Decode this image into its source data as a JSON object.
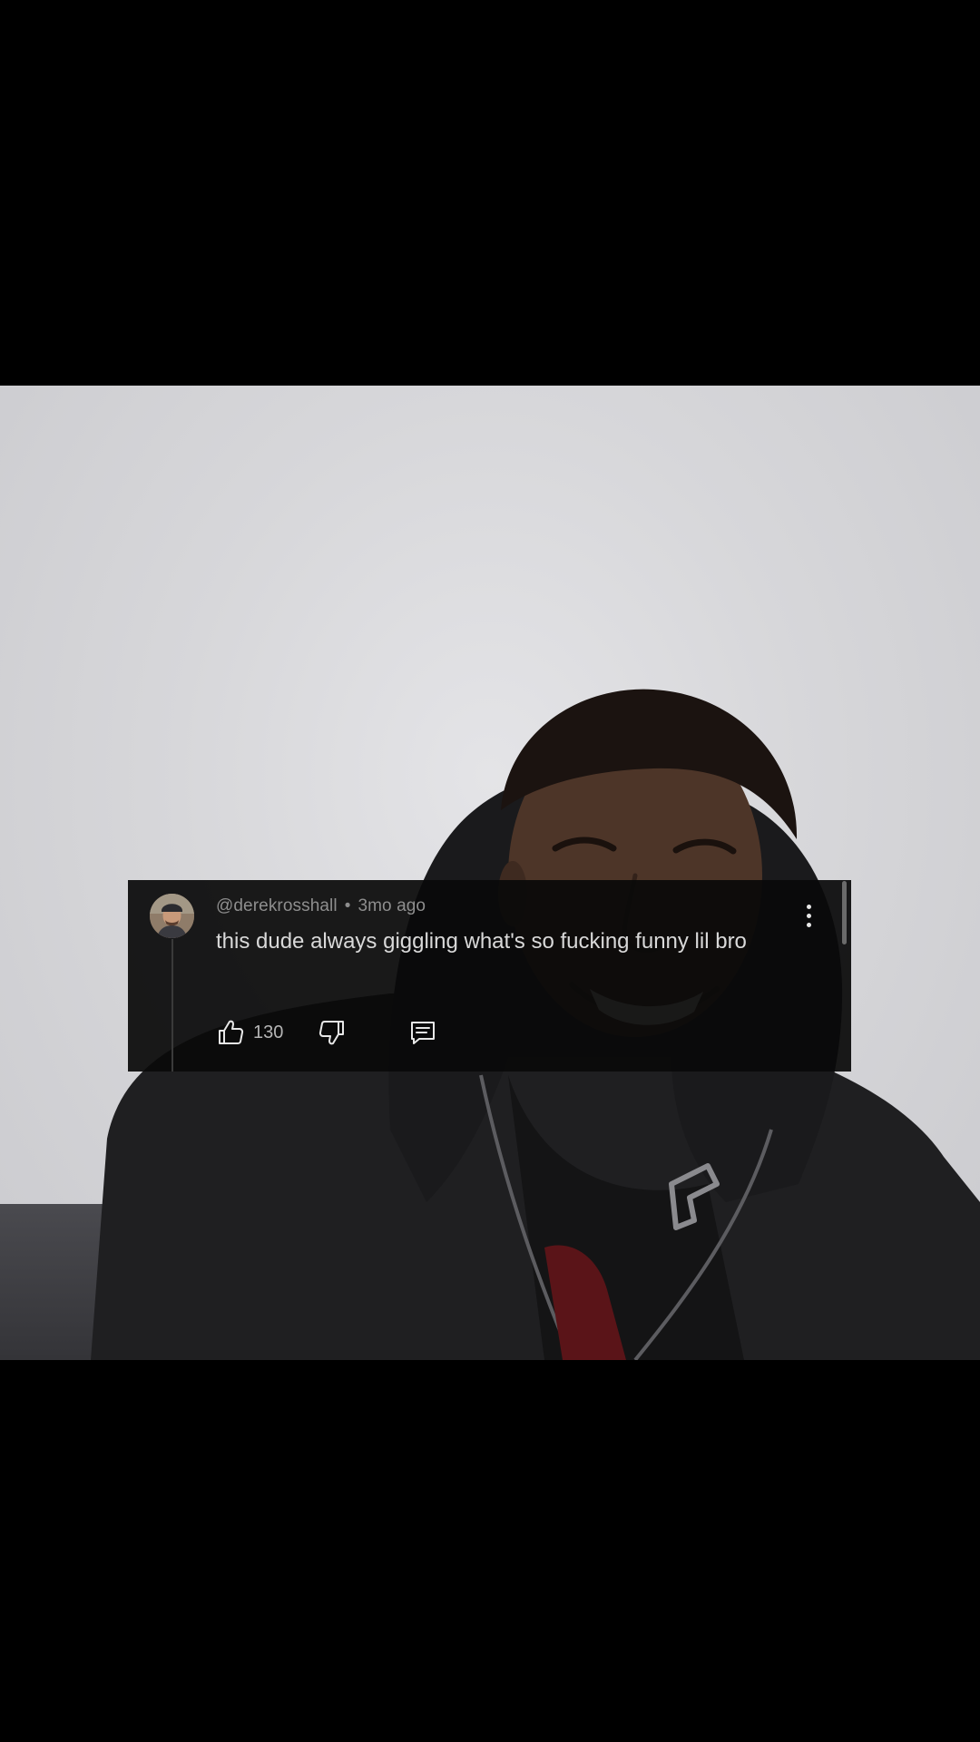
{
  "comment": {
    "author": "@derekrosshall",
    "separator": "•",
    "timestamp": "3mo ago",
    "text": "this dude always giggling what's so fucking funny lil bro",
    "like_count": "130",
    "icons": {
      "avatar": "profile-avatar",
      "more": "more-vertical-icon",
      "like": "thumbs-up-icon",
      "dislike": "thumbs-down-icon",
      "reply": "reply-comment-icon"
    }
  },
  "colors": {
    "page_background": "#000000",
    "video_background": "#d7d7da",
    "card_background": "#0a0a0a",
    "meta_text": "#8e8e8e",
    "body_text": "#d9d9d9",
    "icon": "#e8e8e8"
  }
}
